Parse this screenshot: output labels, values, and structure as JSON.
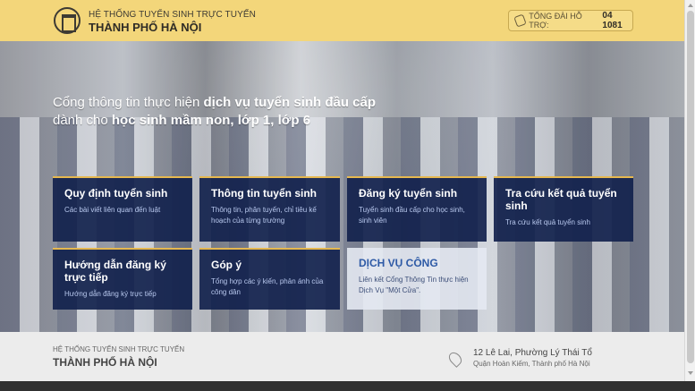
{
  "header": {
    "title_top": "HỆ THỐNG TUYỂN SINH TRỰC TUYẾN",
    "title_main": "THÀNH PHỐ HÀ NỘI",
    "hotline_label": "TỔNG ĐÀI HỖ TRỢ:",
    "hotline_number": "04 1081",
    "icons": {
      "logo": "logo-icon",
      "phone": "phone-icon"
    }
  },
  "hero": {
    "line1_prefix": "Cổng thông tin thực hiện ",
    "line1_bold": "dịch vụ tuyển sinh đầu cấp",
    "line2_prefix": "dành cho ",
    "line2_bold": "học sinh mầm non, lớp 1, lớp 6"
  },
  "tiles": [
    {
      "title": "Quy định tuyển sinh",
      "desc": "Các bài viết liên quan đến luật"
    },
    {
      "title": "Thông tin tuyển sinh",
      "desc": "Thông tin, phân tuyến, chỉ tiêu kế hoạch của từng trường"
    },
    {
      "title": "Đăng ký tuyển sinh",
      "desc": "Tuyển sinh đầu cấp cho học sinh, sinh viên"
    },
    {
      "title": "Tra cứu kết quả tuyển sinh",
      "desc": "Tra cứu kết quả tuyển sinh"
    },
    {
      "title": "Hướng dẫn đăng ký trực tiếp",
      "desc": "Hướng dẫn đăng ký trực tiếp"
    },
    {
      "title": "Góp ý",
      "desc": "Tổng hợp các ý kiến, phản ánh của công dân"
    },
    {
      "title": "DỊCH VỤ CÔNG",
      "desc": "Liên kết Cổng Thông Tin thực hiện Dịch Vụ \"Một Cửa\"."
    }
  ],
  "footer": {
    "title_top": "HỆ THỐNG TUYỂN SINH TRỰC TUYẾN",
    "title_main": "THÀNH PHỐ HÀ NỘI",
    "address_line1": "12 Lê Lai, Phường Lý Thái Tổ",
    "address_line2": "Quận Hoàn Kiếm, Thành phố Hà Nội",
    "icons": {
      "location": "location-pin-icon"
    }
  },
  "colors": {
    "header_bg": "#f3d67a",
    "tile_bg": "#12224d",
    "tile_accent": "#e6b84f",
    "public_service_title": "#2e5aa6"
  }
}
